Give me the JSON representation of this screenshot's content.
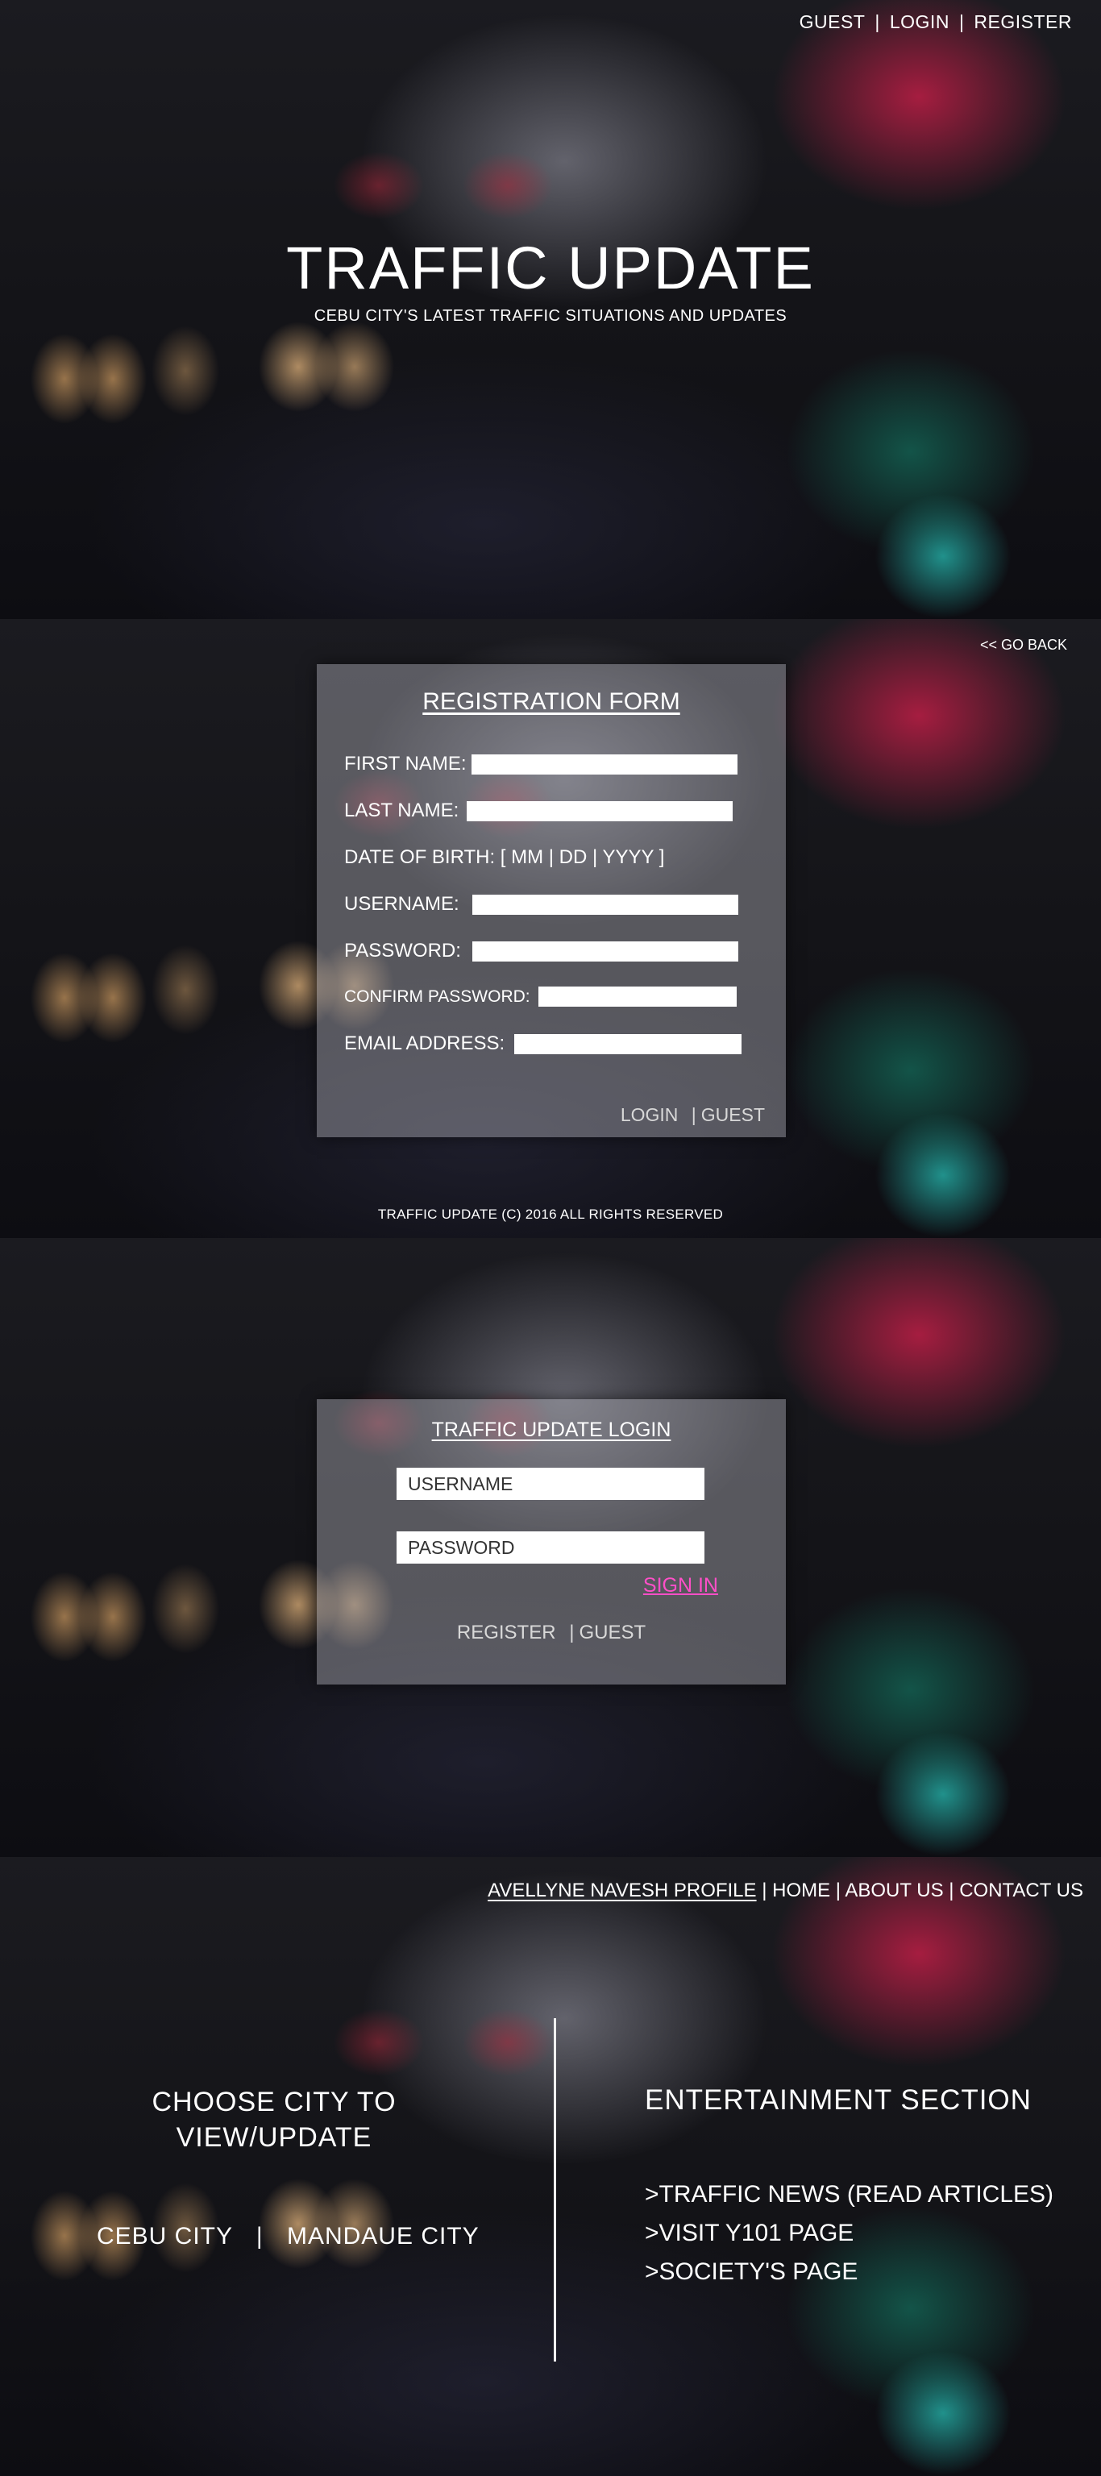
{
  "header": {
    "nav": [
      "GUEST",
      "LOGIN",
      "REGISTER"
    ],
    "separator": "|",
    "title": "TRAFFIC UPDATE",
    "subtitle": "CEBU CITY'S LATEST TRAFFIC SITUATIONS AND UPDATES"
  },
  "registration": {
    "go_back": "<< GO BACK",
    "title": "REGISTRATION FORM",
    "fields": {
      "first_name": "FIRST NAME:",
      "last_name": "LAST NAME:",
      "dob": "DATE OF BIRTH: [ MM | DD | YYYY ]",
      "username": "USERNAME:",
      "password": "PASSWORD:",
      "confirm_password": "CONFIRM PASSWORD:",
      "email": "EMAIL ADDRESS:"
    },
    "links": [
      "LOGIN",
      "GUEST"
    ],
    "separator": "|",
    "footer": "TRAFFIC UPDATE (C) 2016 ALL RIGHTS RESERVED"
  },
  "login": {
    "title": "TRAFFIC UPDATE LOGIN",
    "username_placeholder": "USERNAME",
    "password_placeholder": "PASSWORD",
    "sign_in": "SIGN IN",
    "links": [
      "REGISTER",
      "GUEST"
    ],
    "separator": "|"
  },
  "home": {
    "menu": [
      "AVELLYNE NAVESH PROFILE",
      "HOME",
      "ABOUT US",
      "CONTACT US"
    ],
    "separator": "|",
    "choose_title": "CHOOSE CITY TO VIEW/UPDATE",
    "cities": [
      "CEBU CITY",
      "MANDAUE CITY"
    ],
    "city_separator": "|",
    "entertainment_title": "ENTERTAINMENT SECTION",
    "entertainment_items": [
      ">TRAFFIC NEWS (READ ARTICLES)",
      ">VISIT Y101 PAGE",
      ">SOCIETY'S PAGE"
    ]
  },
  "colors": {
    "sign_in_accent": "#ff4fc8",
    "panel_overlay": "rgba(170,170,180,0.45)"
  }
}
